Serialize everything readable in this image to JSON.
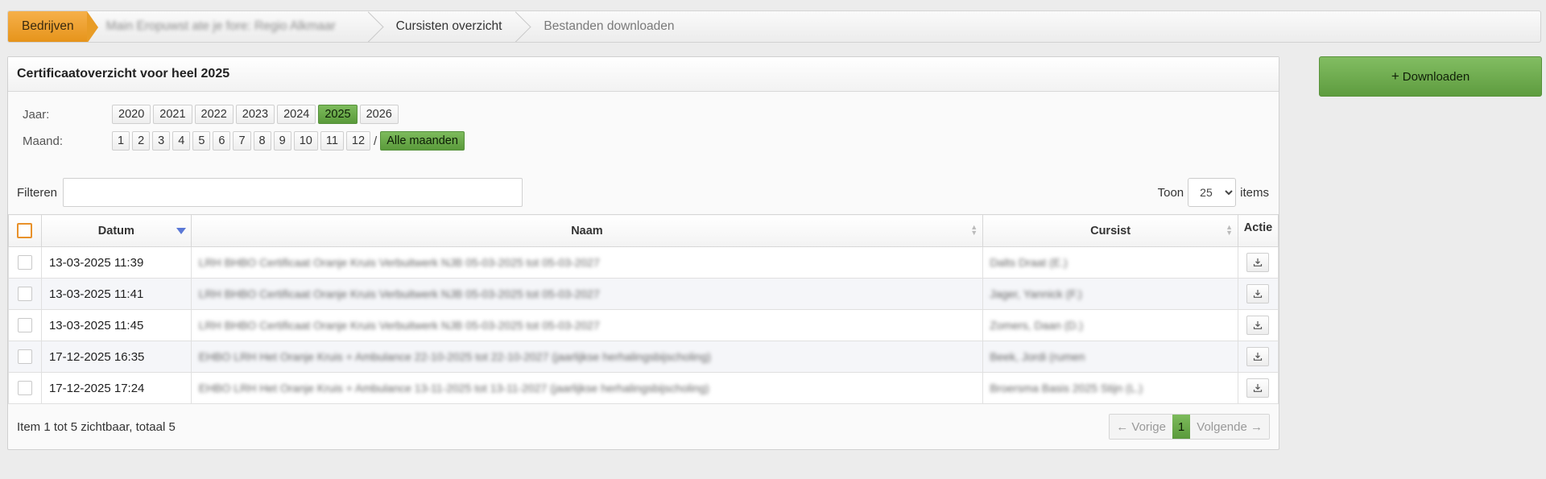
{
  "breadcrumb": {
    "items": [
      {
        "label": "Bedrijven"
      },
      {
        "label": "Main Eropuwst ate je fore: Regio Alkmaar"
      },
      {
        "label": "Cursisten overzicht"
      },
      {
        "label": "Bestanden downloaden"
      }
    ]
  },
  "actions": {
    "download_label": "Downloaden",
    "download_icon": "plus-icon"
  },
  "panel": {
    "title": "Certificaatoverzicht voor heel 2025"
  },
  "year_filter": {
    "label": "Jaar:",
    "options": [
      "2020",
      "2021",
      "2022",
      "2023",
      "2024",
      "2025",
      "2026"
    ],
    "selected": "2025"
  },
  "month_filter": {
    "label": "Maand:",
    "options": [
      "1",
      "2",
      "3",
      "4",
      "5",
      "6",
      "7",
      "8",
      "9",
      "10",
      "11",
      "12"
    ],
    "separator": "/",
    "all_label": "Alle maanden"
  },
  "search": {
    "label": "Filteren",
    "value": "",
    "placeholder": ""
  },
  "page_size": {
    "prefix": "Toon",
    "value": "25",
    "suffix": "items"
  },
  "table": {
    "columns": [
      "Datum",
      "Naam",
      "Cursist",
      "Actie"
    ],
    "sorted_column": "Datum",
    "rows": [
      {
        "date": "13-03-2025 11:39",
        "naam": "LRH BHBO Certificaat Oranje Kruis Verbuitwerk NJB 05-03-2025 tot 05-03-2027",
        "cursist": "Dalts Draat (E.)"
      },
      {
        "date": "13-03-2025 11:41",
        "naam": "LRH BHBO Certificaat Oranje Kruis Verbuitwerk NJB 05-03-2025 tot 05-03-2027",
        "cursist": "Jager, Yannick (F.)"
      },
      {
        "date": "13-03-2025 11:45",
        "naam": "LRH BHBO Certificaat Oranje Kruis Verbuitwerk NJB 05-03-2025 tot 05-03-2027",
        "cursist": "Zomers, Daan (D.)"
      },
      {
        "date": "17-12-2025 16:35",
        "naam": "EHBO LRH Het Oranje Kruis + Ambulance 22-10-2025 tot 22-10-2027 (jaarlijkse herhalingsbijscholing)",
        "cursist": "Beek, Jordi (rumen"
      },
      {
        "date": "17-12-2025 17:24",
        "naam": "EHBO LRH Het Oranje Kruis + Ambulance 13-11-2025 tot 13-11-2027 (jaarlijkse herhalingsbijscholing)",
        "cursist": "Broersma Basis 2025 Stijn (L.)"
      }
    ],
    "row_action_icon": "download-icon"
  },
  "footer": {
    "summary": "Item 1 tot 5 zichtbaar, totaal 5",
    "prev_label": "← Vorige",
    "current_page": "1",
    "next_label": "Volgende →"
  },
  "colors": {
    "accent_orange": "#e6941b",
    "accent_green": "#5e9c3f",
    "sort_arrow": "#5a78d6"
  }
}
